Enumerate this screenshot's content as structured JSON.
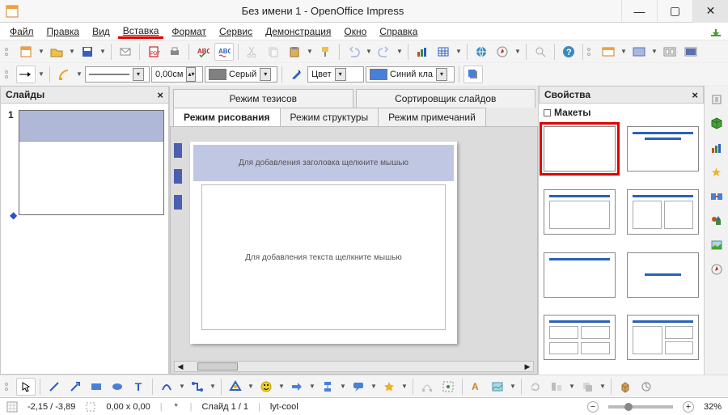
{
  "window": {
    "title": "Без имени 1 - OpenOffice Impress"
  },
  "menu": {
    "file": "Файл",
    "edit": "Правка",
    "view": "Вид",
    "insert": "Вставка",
    "format": "Формат",
    "tools": "Сервис",
    "slideshow": "Демонстрация",
    "window": "Окно",
    "help": "Справка"
  },
  "toolbar2": {
    "size_value": "0,00см",
    "color1_label": "Серый",
    "color2_prefix": "Цвет",
    "color2_label": "Синий кла"
  },
  "panels": {
    "slides_title": "Слайды",
    "props_title": "Свойства",
    "layouts_title": "Макеты",
    "slide_number": "1"
  },
  "view_tabs": {
    "outline_top": "Режим тезисов",
    "sorter_top": "Сортировщик слайдов",
    "drawing": "Режим рисования",
    "structure": "Режим структуры",
    "notes": "Режим примечаний"
  },
  "canvas": {
    "title_placeholder": "Для добавления заголовка щелкните мышью",
    "content_placeholder": "Для добавления текста щелкните мышью"
  },
  "status": {
    "coords": "-2,15 / -3,89",
    "size": "0,00 x 0,00",
    "slide": "Слайд 1 / 1",
    "layout_name": "lyt-cool",
    "zoom": "32%"
  }
}
